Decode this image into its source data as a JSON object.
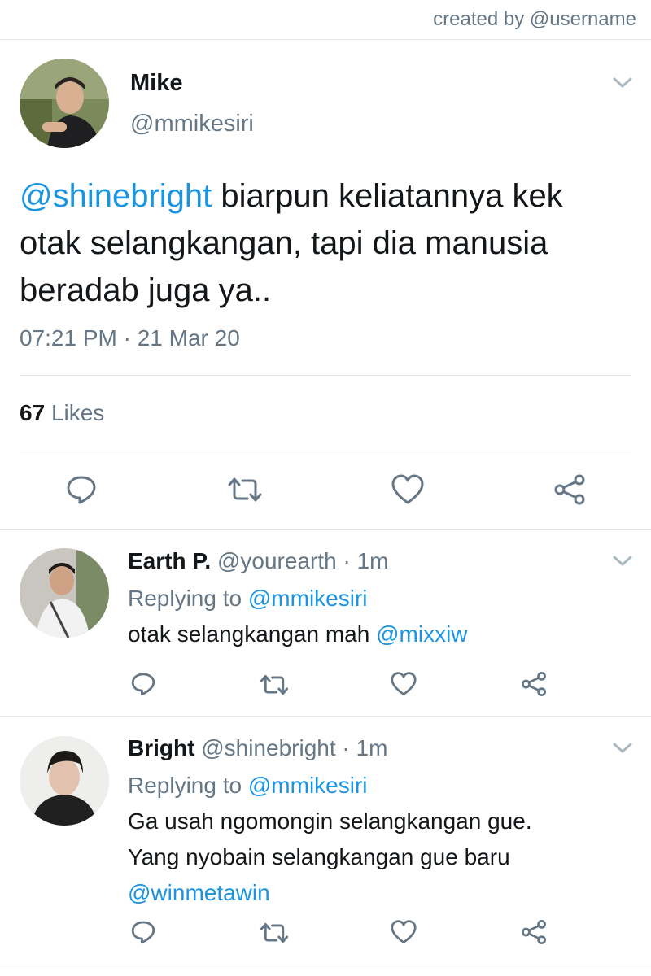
{
  "credit": "created by @username",
  "main_tweet": {
    "name": "Mike",
    "handle": "@mmikesiri",
    "mention": "@shinebright",
    "text_line1": " biarpun keliatannya kek",
    "text_line2": "otak selangkangan, tapi dia manusia",
    "text_line3": "beradab juga ya..",
    "timestamp": "07:21 PM · 21 Mar 20",
    "likes_count": "67",
    "likes_label": "Likes"
  },
  "replies": [
    {
      "name": "Earth P.",
      "handle": "@yourearth",
      "time": "· 1m",
      "replying_prefix": "Replying to",
      "replying_to": "@mmikesiri",
      "text": "otak selangkangan mah ",
      "mention": "@mixxiw"
    },
    {
      "name": "Bright",
      "handle": "@shinebright",
      "time": "· 1m",
      "replying_prefix": "Replying to",
      "replying_to": "@mmikesiri",
      "text_line1": "Ga usah ngomongin selangkangan gue.",
      "text_line2": "Yang nyobain selangkangan gue baru",
      "mention": "@winmetawin"
    }
  ],
  "colors": {
    "link": "#1b95e0",
    "secondary": "#657786",
    "divider": "#e1e8ed"
  },
  "icons": [
    "reply-icon",
    "retweet-icon",
    "like-icon",
    "share-icon",
    "chevron-down-icon"
  ]
}
